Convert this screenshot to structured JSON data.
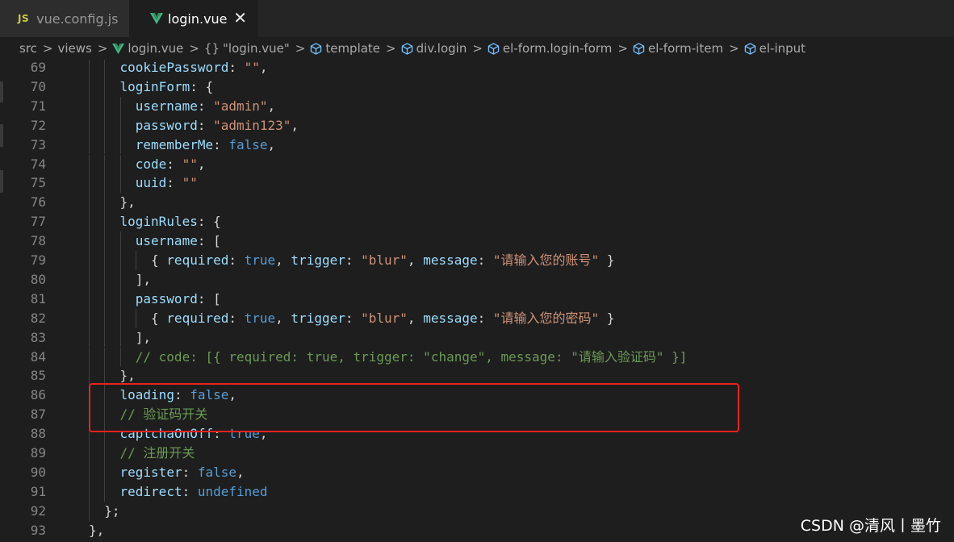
{
  "tabs": [
    {
      "icon": "js-file-icon",
      "icon_text": "JS",
      "label": "vue.config.js",
      "active": false
    },
    {
      "icon": "vue-file-icon",
      "label": "login.vue",
      "active": true,
      "close": "✕"
    }
  ],
  "breadcrumbs": [
    "src",
    "views",
    "login.vue",
    "\"login.vue\"",
    "template",
    "div.login",
    "el-form.login-form",
    "el-form-item",
    "el-input"
  ],
  "breadcrumb_braces": "{}",
  "breadcrumb_separator": ">",
  "code_lines": [
    {
      "n": "69",
      "indent": 2,
      "tokens": [
        [
          "prop",
          "cookiePassword"
        ],
        [
          "punc",
          ": "
        ],
        [
          "str",
          "\"\""
        ],
        [
          "punc",
          ","
        ]
      ]
    },
    {
      "n": "70",
      "indent": 2,
      "tokens": [
        [
          "prop",
          "loginForm"
        ],
        [
          "punc",
          ": {"
        ]
      ]
    },
    {
      "n": "71",
      "indent": 3,
      "tokens": [
        [
          "prop",
          "username"
        ],
        [
          "punc",
          ": "
        ],
        [
          "str",
          "\"admin\""
        ],
        [
          "punc",
          ","
        ]
      ]
    },
    {
      "n": "72",
      "indent": 3,
      "tokens": [
        [
          "prop",
          "password"
        ],
        [
          "punc",
          ": "
        ],
        [
          "str",
          "\"admin123\""
        ],
        [
          "punc",
          ","
        ]
      ]
    },
    {
      "n": "73",
      "indent": 3,
      "tokens": [
        [
          "prop",
          "rememberMe"
        ],
        [
          "punc",
          ": "
        ],
        [
          "kw",
          "false"
        ],
        [
          "punc",
          ","
        ]
      ]
    },
    {
      "n": "74",
      "indent": 3,
      "tokens": [
        [
          "prop",
          "code"
        ],
        [
          "punc",
          ": "
        ],
        [
          "str",
          "\"\""
        ],
        [
          "punc",
          ","
        ]
      ]
    },
    {
      "n": "75",
      "indent": 3,
      "tokens": [
        [
          "prop",
          "uuid"
        ],
        [
          "punc",
          ": "
        ],
        [
          "str",
          "\"\""
        ]
      ]
    },
    {
      "n": "76",
      "indent": 2,
      "tokens": [
        [
          "punc",
          "},"
        ]
      ]
    },
    {
      "n": "77",
      "indent": 2,
      "tokens": [
        [
          "prop",
          "loginRules"
        ],
        [
          "punc",
          ": {"
        ]
      ]
    },
    {
      "n": "78",
      "indent": 3,
      "tokens": [
        [
          "prop",
          "username"
        ],
        [
          "punc",
          ": ["
        ]
      ]
    },
    {
      "n": "79",
      "indent": 4,
      "tokens": [
        [
          "punc",
          "{ "
        ],
        [
          "prop",
          "required"
        ],
        [
          "punc",
          ": "
        ],
        [
          "kw",
          "true"
        ],
        [
          "punc",
          ", "
        ],
        [
          "prop",
          "trigger"
        ],
        [
          "punc",
          ": "
        ],
        [
          "str",
          "\"blur\""
        ],
        [
          "punc",
          ", "
        ],
        [
          "prop",
          "message"
        ],
        [
          "punc",
          ": "
        ],
        [
          "str",
          "\"请输入您的账号\""
        ],
        [
          "punc",
          " }"
        ]
      ]
    },
    {
      "n": "80",
      "indent": 3,
      "tokens": [
        [
          "punc",
          "],"
        ]
      ]
    },
    {
      "n": "81",
      "indent": 3,
      "tokens": [
        [
          "prop",
          "password"
        ],
        [
          "punc",
          ": ["
        ]
      ]
    },
    {
      "n": "82",
      "indent": 4,
      "tokens": [
        [
          "punc",
          "{ "
        ],
        [
          "prop",
          "required"
        ],
        [
          "punc",
          ": "
        ],
        [
          "kw",
          "true"
        ],
        [
          "punc",
          ", "
        ],
        [
          "prop",
          "trigger"
        ],
        [
          "punc",
          ": "
        ],
        [
          "str",
          "\"blur\""
        ],
        [
          "punc",
          ", "
        ],
        [
          "prop",
          "message"
        ],
        [
          "punc",
          ": "
        ],
        [
          "str",
          "\"请输入您的密码\""
        ],
        [
          "punc",
          " }"
        ]
      ]
    },
    {
      "n": "83",
      "indent": 3,
      "tokens": [
        [
          "punc",
          "],"
        ]
      ]
    },
    {
      "n": "84",
      "indent": 3,
      "tokens": [
        [
          "cmt",
          "// code: [{ required: true, trigger: \"change\", message: \"请输入验证码\" }]"
        ]
      ]
    },
    {
      "n": "85",
      "indent": 2,
      "tokens": [
        [
          "punc",
          "},"
        ]
      ]
    },
    {
      "n": "86",
      "indent": 2,
      "tokens": [
        [
          "prop",
          "loading"
        ],
        [
          "punc",
          ": "
        ],
        [
          "kw",
          "false"
        ],
        [
          "punc",
          ","
        ]
      ]
    },
    {
      "n": "87",
      "indent": 2,
      "tokens": [
        [
          "cmt",
          "// 验证码开关"
        ]
      ]
    },
    {
      "n": "88",
      "indent": 2,
      "tokens": [
        [
          "prop",
          "captchaOnOff"
        ],
        [
          "punc",
          ": "
        ],
        [
          "kw",
          "true"
        ],
        [
          "punc",
          ","
        ]
      ]
    },
    {
      "n": "89",
      "indent": 2,
      "tokens": [
        [
          "cmt",
          "// 注册开关"
        ]
      ]
    },
    {
      "n": "90",
      "indent": 2,
      "tokens": [
        [
          "prop",
          "register"
        ],
        [
          "punc",
          ": "
        ],
        [
          "kw",
          "false"
        ],
        [
          "punc",
          ","
        ]
      ]
    },
    {
      "n": "91",
      "indent": 2,
      "tokens": [
        [
          "prop",
          "redirect"
        ],
        [
          "punc",
          ": "
        ],
        [
          "kw",
          "undefined"
        ]
      ]
    },
    {
      "n": "92",
      "indent": 1,
      "tokens": [
        [
          "punc",
          "};"
        ]
      ]
    },
    {
      "n": "93",
      "indent": 0,
      "tokens": [
        [
          "punc",
          "},"
        ]
      ]
    }
  ],
  "watermark": "CSDN @清风丨墨竹",
  "colors": {
    "editor_bg": "#1e1e1e",
    "property": "#9cdcfe",
    "string": "#ce9178",
    "keyword": "#569cd6",
    "comment": "#6a9955",
    "highlight_box": "#e8231d"
  }
}
